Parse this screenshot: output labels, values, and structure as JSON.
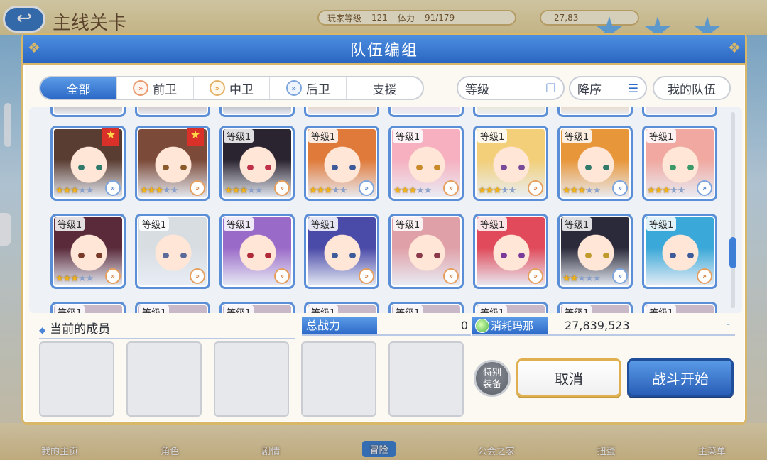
{
  "background": {
    "title": "主线关卡",
    "player_level_label": "玩家等级",
    "player_level": "121",
    "stamina_label": "体力",
    "stamina": "91/179",
    "money": "27,83",
    "nav": [
      "我的主页",
      "角色",
      "剧情",
      "冒险",
      "公会之家",
      "扭蛋",
      "主菜单"
    ]
  },
  "dialog": {
    "title": "队伍编组",
    "tabs": [
      {
        "label": "全部",
        "icon": ""
      },
      {
        "label": "前卫",
        "icon": "front-icon"
      },
      {
        "label": "中卫",
        "icon": "middle-icon"
      },
      {
        "label": "后卫",
        "icon": "rear-icon"
      },
      {
        "label": "支援",
        "icon": ""
      }
    ],
    "sort_label": "等级",
    "order_label": "降序",
    "my_team_label": "我的队伍"
  },
  "roster": {
    "level_label": "等级1",
    "row1": [
      {
        "stars": 3,
        "max": 5,
        "fav": true,
        "level": false,
        "hair": "#5a3d32",
        "eyes": "#2f7a6a",
        "arrow": "blue"
      },
      {
        "stars": 3,
        "max": 5,
        "fav": true,
        "level": false,
        "hair": "#7b4a38",
        "eyes": "#8a5a2a",
        "arrow": "orange"
      },
      {
        "stars": 3,
        "max": 5,
        "fav": false,
        "level": true,
        "hair": "#2a2330",
        "eyes": "#c0304a",
        "arrow": "orange"
      },
      {
        "stars": 3,
        "max": 5,
        "fav": false,
        "level": true,
        "hair": "#e07a3a",
        "eyes": "#3d5a9a",
        "arrow": "blue"
      },
      {
        "stars": 3,
        "max": 5,
        "fav": false,
        "level": true,
        "hair": "#f6b0c0",
        "eyes": "#c98a2a",
        "arrow": "orange"
      },
      {
        "stars": 3,
        "max": 5,
        "fav": false,
        "level": true,
        "hair": "#f2cf78",
        "eyes": "#7a4a9a",
        "arrow": "orange"
      },
      {
        "stars": 3,
        "max": 5,
        "fav": false,
        "level": true,
        "hair": "#e8963a",
        "eyes": "#2f7a6a",
        "arrow": "blue"
      },
      {
        "stars": 3,
        "max": 5,
        "fav": false,
        "level": true,
        "hair": "#f0a8a0",
        "eyes": "#3a9a6a",
        "arrow": "blue"
      }
    ],
    "row2": [
      {
        "stars": 3,
        "max": 5,
        "level": true,
        "hair": "#5a2a3a",
        "eyes": "#7a3a2a",
        "arrow": "orange"
      },
      {
        "stars": 0,
        "max": 0,
        "level": true,
        "hair": "#d8dde2",
        "eyes": "#5a6a9a",
        "arrow": "orange"
      },
      {
        "stars": 0,
        "max": 0,
        "level": true,
        "hair": "#9a6ac8",
        "eyes": "#b02a3a",
        "arrow": "orange"
      },
      {
        "stars": 0,
        "max": 0,
        "level": true,
        "hair": "#4a4aa8",
        "eyes": "#3d5a9a",
        "arrow": "orange"
      },
      {
        "stars": 0,
        "max": 0,
        "level": true,
        "hair": "#e0a0a8",
        "eyes": "#8a3a4a",
        "arrow": "orange"
      },
      {
        "stars": 0,
        "max": 0,
        "level": true,
        "hair": "#e04a5a",
        "eyes": "#7a3a9a",
        "arrow": "orange"
      },
      {
        "stars": 2,
        "max": 5,
        "level": true,
        "hair": "#2a2a3a",
        "eyes": "#c09a2a",
        "arrow": "blue"
      },
      {
        "stars": 0,
        "max": 0,
        "level": true,
        "hair": "#3aa8d8",
        "eyes": "#3d5a9a",
        "arrow": "orange"
      }
    ]
  },
  "info": {
    "members_label": "当前的成员",
    "power_label": "总战力",
    "power_value": "0",
    "mana_label": "消耗玛那",
    "mana_value": "27,839,523",
    "mana_dash": "-"
  },
  "buttons": {
    "special_equipment": "特别装备",
    "cancel": "取消",
    "start": "战斗开始"
  },
  "colors": {
    "accent": "#2d6ac8",
    "gold": "#d8b768",
    "card_border": "#5a8ed6"
  }
}
